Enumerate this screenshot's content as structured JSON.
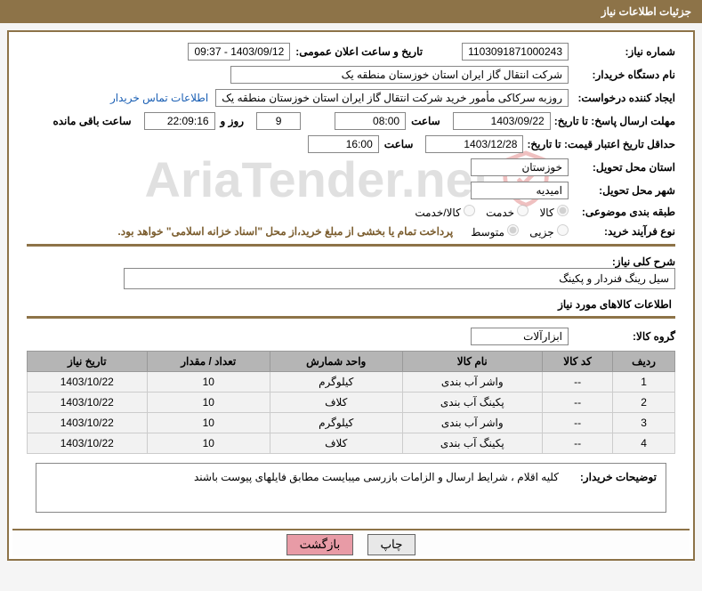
{
  "header": "جزئیات اطلاعات نیاز",
  "fields": {
    "need_no_lbl": "شماره نیاز:",
    "need_no": "1103091871000243",
    "ann_dt_lbl": "تاریخ و ساعت اعلان عمومی:",
    "ann_dt": "1403/09/12 - 09:37",
    "buyer_org_lbl": "نام دستگاه خریدار:",
    "buyer_org": "شرکت انتقال گاز ایران  استان خوزستان منطقه یک",
    "requester_lbl": "ایجاد کننده درخواست:",
    "requester": "روزبه سرکاکی مأمور خرید شرکت انتقال گاز ایران  استان خوزستان منطقه یک",
    "contact_link": "اطلاعات تماس خریدار",
    "resp_deadline_lbl": "مهلت ارسال پاسخ: تا تاریخ:",
    "resp_date": "1403/09/22",
    "time_lbl": "ساعت",
    "resp_time": "08:00",
    "days": "9",
    "days_lbl": "روز و",
    "countdown": "22:09:16",
    "remain_lbl": "ساعت باقی مانده",
    "price_valid_lbl": "حداقل تاریخ اعتبار قیمت: تا تاریخ:",
    "price_date": "1403/12/28",
    "price_time": "16:00",
    "province_lbl": "استان محل تحویل:",
    "province": "خوزستان",
    "city_lbl": "شهر محل تحویل:",
    "city": "امیدیه",
    "cat_lbl": "طبقه بندی موضوعی:",
    "cat_opts": [
      "کالا",
      "خدمت",
      "کالا/خدمت"
    ],
    "proc_lbl": "نوع فرآیند خرید:",
    "proc_opts": [
      "جزیی",
      "متوسط"
    ],
    "pay_note": "پرداخت تمام یا بخشی از مبلغ خرید،از محل \"اسناد خزانه اسلامی\" خواهد بود.",
    "desc_lbl": "شرح کلی نیاز:",
    "desc": "سیل رینگ فنردار و پکینگ",
    "goods_section": "اطلاعات کالاهای مورد نیاز",
    "group_lbl": "گروه کالا:",
    "group": "ابزارآلات"
  },
  "table": {
    "headers": [
      "ردیف",
      "کد کالا",
      "نام کالا",
      "واحد شمارش",
      "تعداد / مقدار",
      "تاریخ نیاز"
    ],
    "rows": [
      [
        "1",
        "--",
        "واشر آب بندی",
        "کیلوگرم",
        "10",
        "1403/10/22"
      ],
      [
        "2",
        "--",
        "پکینگ آب بندی",
        "کلاف",
        "10",
        "1403/10/22"
      ],
      [
        "3",
        "--",
        "واشر آب بندی",
        "کیلوگرم",
        "10",
        "1403/10/22"
      ],
      [
        "4",
        "--",
        "پکینگ آب بندی",
        "کلاف",
        "10",
        "1403/10/22"
      ]
    ]
  },
  "buyer_notes_lbl": "توضیحات خریدار:",
  "buyer_notes": "کلیه اقلام ، شرایط ارسال و الزامات بازرسی میبایست مطابق فایلهای پیوست باشند",
  "buttons": {
    "print": "چاپ",
    "back": "بازگشت"
  },
  "watermark": "AriaTender.net"
}
